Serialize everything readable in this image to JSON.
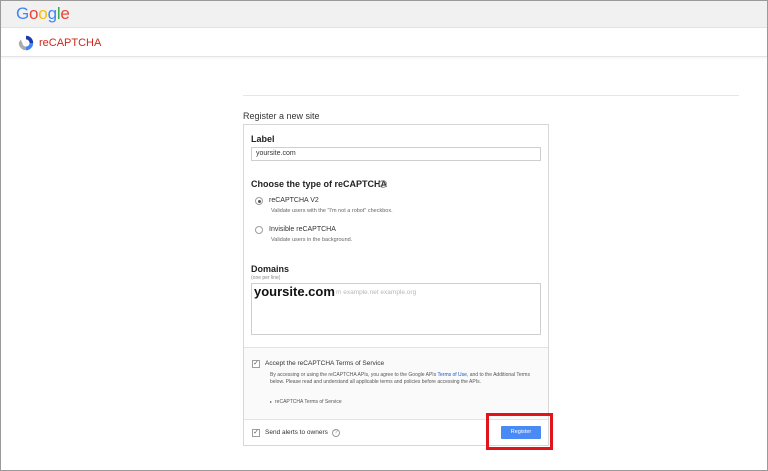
{
  "header": {
    "google_logo_letters": [
      {
        "char": "G",
        "color": "#4285F4"
      },
      {
        "char": "o",
        "color": "#EA4335"
      },
      {
        "char": "o",
        "color": "#FBBC05"
      },
      {
        "char": "g",
        "color": "#4285F4"
      },
      {
        "char": "l",
        "color": "#34A853"
      },
      {
        "char": "e",
        "color": "#EA4335"
      }
    ]
  },
  "brand": {
    "name": "reCAPTCHA",
    "accent_color": "#d2271d",
    "icon": "recaptcha-icon"
  },
  "page": {
    "heading": "Register a new site"
  },
  "form": {
    "label_section": {
      "title": "Label",
      "value": "yoursite.com"
    },
    "type_section": {
      "title": "Choose the type of reCAPTCHA",
      "help_symbol": "?",
      "options": [
        {
          "title": "reCAPTCHA V2",
          "description": "Validate users with the \"I'm not a robot\" checkbox.",
          "selected": true
        },
        {
          "title": "Invisible reCAPTCHA",
          "description": "Validate users in the background.",
          "selected": false
        }
      ]
    },
    "domains_section": {
      "title": "Domains",
      "hint": "(one per line)",
      "placeholder_visible": "m example.net example.org",
      "typed_value": "yoursite.com"
    },
    "terms": {
      "checked": true,
      "check_glyph": "✓",
      "title": "Accept the reCAPTCHA Terms of Service",
      "body_before_link": "By accessing or using the reCAPTCHA APIs, you agree to the Google APIs ",
      "link_text": "Terms of Use",
      "body_after_link": ", and to the Additional Terms below. Please read and understand all applicable terms and policies before accessing the APIs.",
      "expand_caret": "▸",
      "expand_label": "reCAPTCHA Terms of Service"
    },
    "alerts": {
      "checked": true,
      "check_glyph": "✓",
      "label": "Send alerts to owners",
      "help_symbol": "?"
    },
    "register_button": {
      "label": "Register",
      "color": "#4a8af4"
    }
  },
  "annotation": {
    "highlight_color": "#e0141a"
  }
}
